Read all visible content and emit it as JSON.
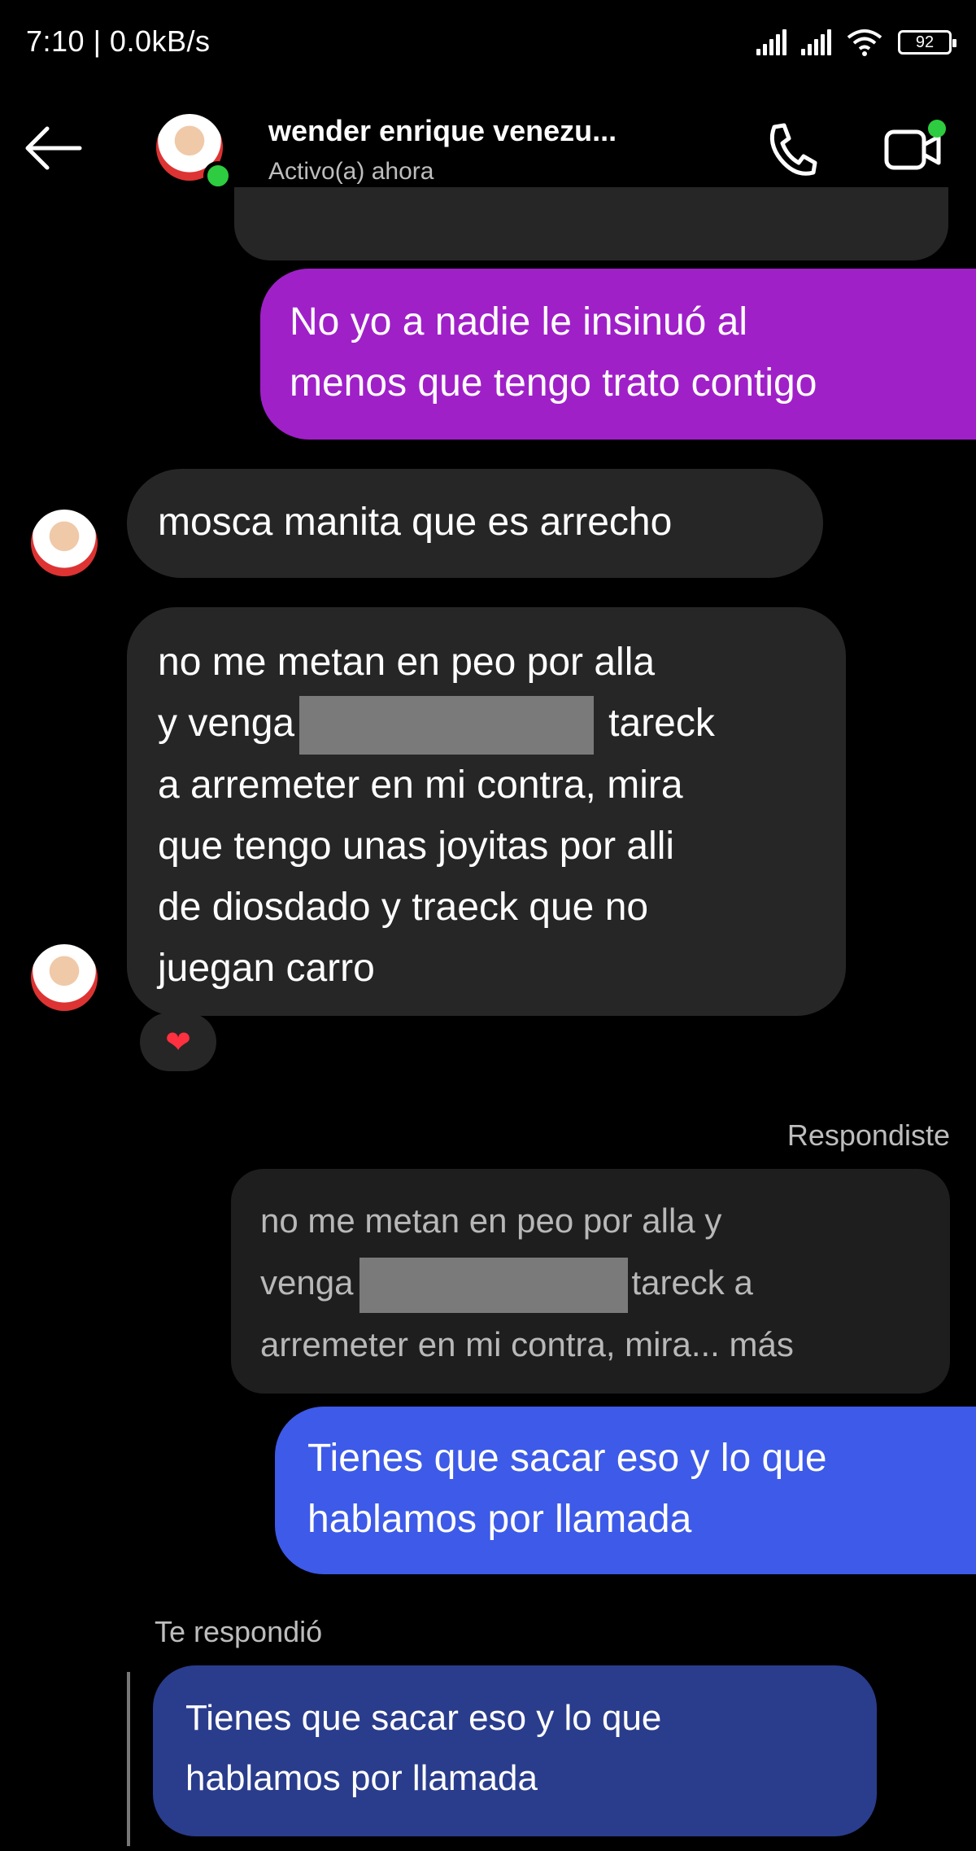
{
  "status_bar": {
    "time": "7:10 | 0.0kB/s",
    "battery": "92"
  },
  "header": {
    "contact_name": "wender enrique venezu...",
    "contact_status": "Activo(a) ahora"
  },
  "messages": {
    "m1": {
      "line1": "No yo a nadie le insinuó al",
      "line2": "menos que tengo trato contigo"
    },
    "m2": {
      "line1": "mosca manita que es arrecho"
    },
    "m3": {
      "line1": "no me metan en peo por alla",
      "line2_a": "y venga",
      "line2_b": "tareck",
      "line3": "a arremeter en mi contra, mira",
      "line4": "que tengo unas joyitas por alli",
      "line5": "de diosdado y traeck que no",
      "line6": "juegan carro",
      "reaction": "❤"
    },
    "reply_label": "Respondiste",
    "quoted": {
      "line1": "no me metan en peo por alla y",
      "line2_a": "venga",
      "line2_b": "tareck a",
      "line3": "arremeter en mi contra, mira... más"
    },
    "m4": {
      "line1": "Tienes que sacar eso y lo que",
      "line2": "hablamos por llamada"
    },
    "reply_label_2": "Te respondió",
    "m5": {
      "line1": "Tienes que sacar eso y lo que",
      "line2": "hablamos por llamada"
    }
  },
  "colors": {
    "sent_purple": "#a020c8",
    "sent_blue": "#3d5ae8",
    "received": "#262626",
    "online": "#2ecc40"
  }
}
